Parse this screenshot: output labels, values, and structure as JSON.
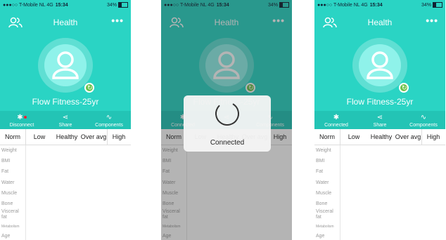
{
  "status_bar": {
    "carrier": "●●●○○ T-Mobile NL",
    "network": "4G",
    "time": "15:34",
    "battery": "34%",
    "battery_level": 0.34
  },
  "header": {
    "title": "Health",
    "more": "•••"
  },
  "profile": {
    "name": "Flow Fitness-25yr"
  },
  "actions": {
    "disconnect": "Disconnect",
    "connected": "Connected",
    "share": "Share",
    "components": "Components"
  },
  "table": {
    "columns": [
      "Norm",
      "Low",
      "Healthy",
      "Over avg",
      "High"
    ]
  },
  "metrics": [
    "Weight",
    "BMI",
    "Fat",
    "Water",
    "Muscle",
    "Bone",
    "Visceral fat",
    "Metabolism",
    "Age"
  ],
  "toast": {
    "message": "Connected"
  },
  "colors": {
    "teal": "#2ad4c4",
    "teal_dark": "#23c4b5",
    "sync_green": "#6cc24a"
  }
}
